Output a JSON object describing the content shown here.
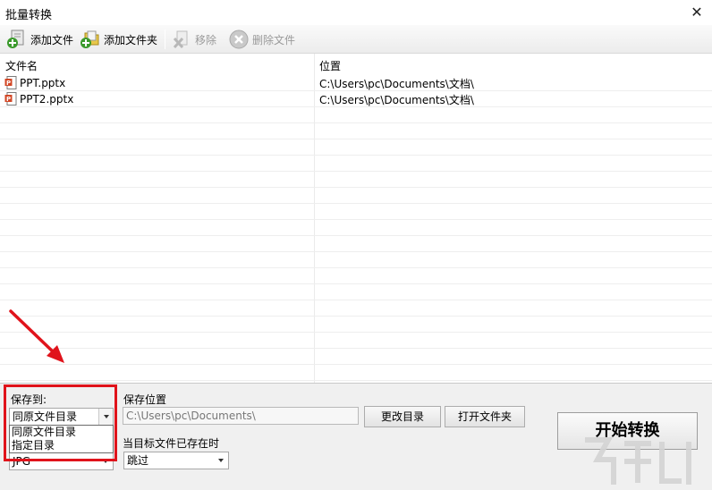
{
  "window": {
    "title": "批量转换",
    "close_glyph": "✕"
  },
  "toolbar": {
    "add_file": "添加文件",
    "add_folder": "添加文件夹",
    "remove": "移除",
    "delete_file": "删除文件"
  },
  "list": {
    "columns": [
      "文件名",
      "位置"
    ],
    "rows": [
      {
        "name": "PPT.pptx",
        "location": "C:\\Users\\pc\\Documents\\文档\\"
      },
      {
        "name": "PPT2.pptx",
        "location": "C:\\Users\\pc\\Documents\\文档\\"
      }
    ]
  },
  "bottom": {
    "save_to_label": "保存到:",
    "save_to_value": "同原文件目录",
    "save_to_options": [
      "同原文件目录",
      "指定目录"
    ],
    "format_value": "JPG",
    "save_location_label": "保存位置",
    "save_location_value": "C:\\Users\\pc\\Documents\\",
    "change_dir": "更改目录",
    "open_folder": "打开文件夹",
    "exists_label": "当目标文件已存在时",
    "exists_value": "跳过",
    "start": "开始转换"
  },
  "colors": {
    "highlight": "#e0131b",
    "arrow": "#e0131b"
  }
}
